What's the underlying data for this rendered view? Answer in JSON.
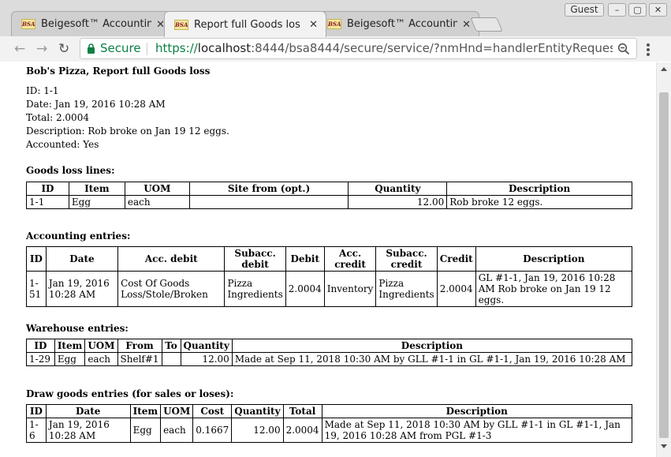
{
  "browser": {
    "tabs": [
      {
        "favicon": "BSA",
        "title": "Beigesoft™ Accountin",
        "active": false
      },
      {
        "favicon": "BSA",
        "title": "Report full Goods los",
        "active": true
      },
      {
        "favicon": "BSA",
        "title": "Beigesoft™ Accountin",
        "active": false
      }
    ],
    "guest_label": "Guest",
    "secure_label": "Secure",
    "url_scheme": "https://",
    "url_host": "localhost",
    "url_rest": ":8444/bsa8444/secure/service/?nmHnd=handlerEntityRequest..."
  },
  "report": {
    "title": "Bob's Pizza, Report full Goods loss",
    "fields": [
      "ID: 1-1",
      "Date: Jan 19, 2016 10:28 AM",
      "Total: 2.0004",
      "Description: Rob broke on Jan 19 12 eggs.",
      "Accounted: Yes"
    ],
    "goods_loss": {
      "heading": "Goods loss lines:",
      "headers": [
        "ID",
        "Item",
        "UOM",
        "Site from (opt.)",
        "Quantity",
        "Description"
      ],
      "rows": [
        [
          "1-1",
          "Egg",
          "each",
          "",
          "12.00",
          "Rob broke 12 eggs."
        ]
      ]
    },
    "accounting": {
      "heading": "Accounting entries:",
      "headers": [
        "ID",
        "Date",
        "Acc. debit",
        "Subacc. debit",
        "Debit",
        "Acc. credit",
        "Subacc. credit",
        "Credit",
        "Description"
      ],
      "rows": [
        [
          "1-51",
          "Jan 19, 2016 10:28 AM",
          "Cost Of Goods Loss/Stole/Broken",
          "Pizza Ingredients",
          "2.0004",
          "Inventory",
          "Pizza Ingredients",
          "2.0004",
          "GL #1-1, Jan 19, 2016 10:28 AM Rob broke on Jan 19 12 eggs."
        ]
      ]
    },
    "warehouse": {
      "heading": "Warehouse entries:",
      "headers": [
        "ID",
        "Item",
        "UOM",
        "From",
        "To",
        "Quantity",
        "Description"
      ],
      "rows": [
        [
          "1-29",
          "Egg",
          "each",
          "Shelf#1",
          "",
          "12.00",
          "Made at Sep 11, 2018 10:30 AM by GLL #1-1 in GL #1-1, Jan 19, 2016 10:28 AM"
        ]
      ]
    },
    "draw_goods": {
      "heading": "Draw goods entries (for sales or loses):",
      "headers": [
        "ID",
        "Date",
        "Item",
        "UOM",
        "Cost",
        "Quantity",
        "Total",
        "Description"
      ],
      "rows": [
        [
          "1-6",
          "Jan 19, 2016 10:28 AM",
          "Egg",
          "each",
          "0.1667",
          "12.00",
          "2.0004",
          "Made at Sep 11, 2018 10:30 AM by GLL #1-1 in GL #1-1, Jan 19, 2016 10:28 AM from PGL #1-3"
        ]
      ]
    }
  }
}
